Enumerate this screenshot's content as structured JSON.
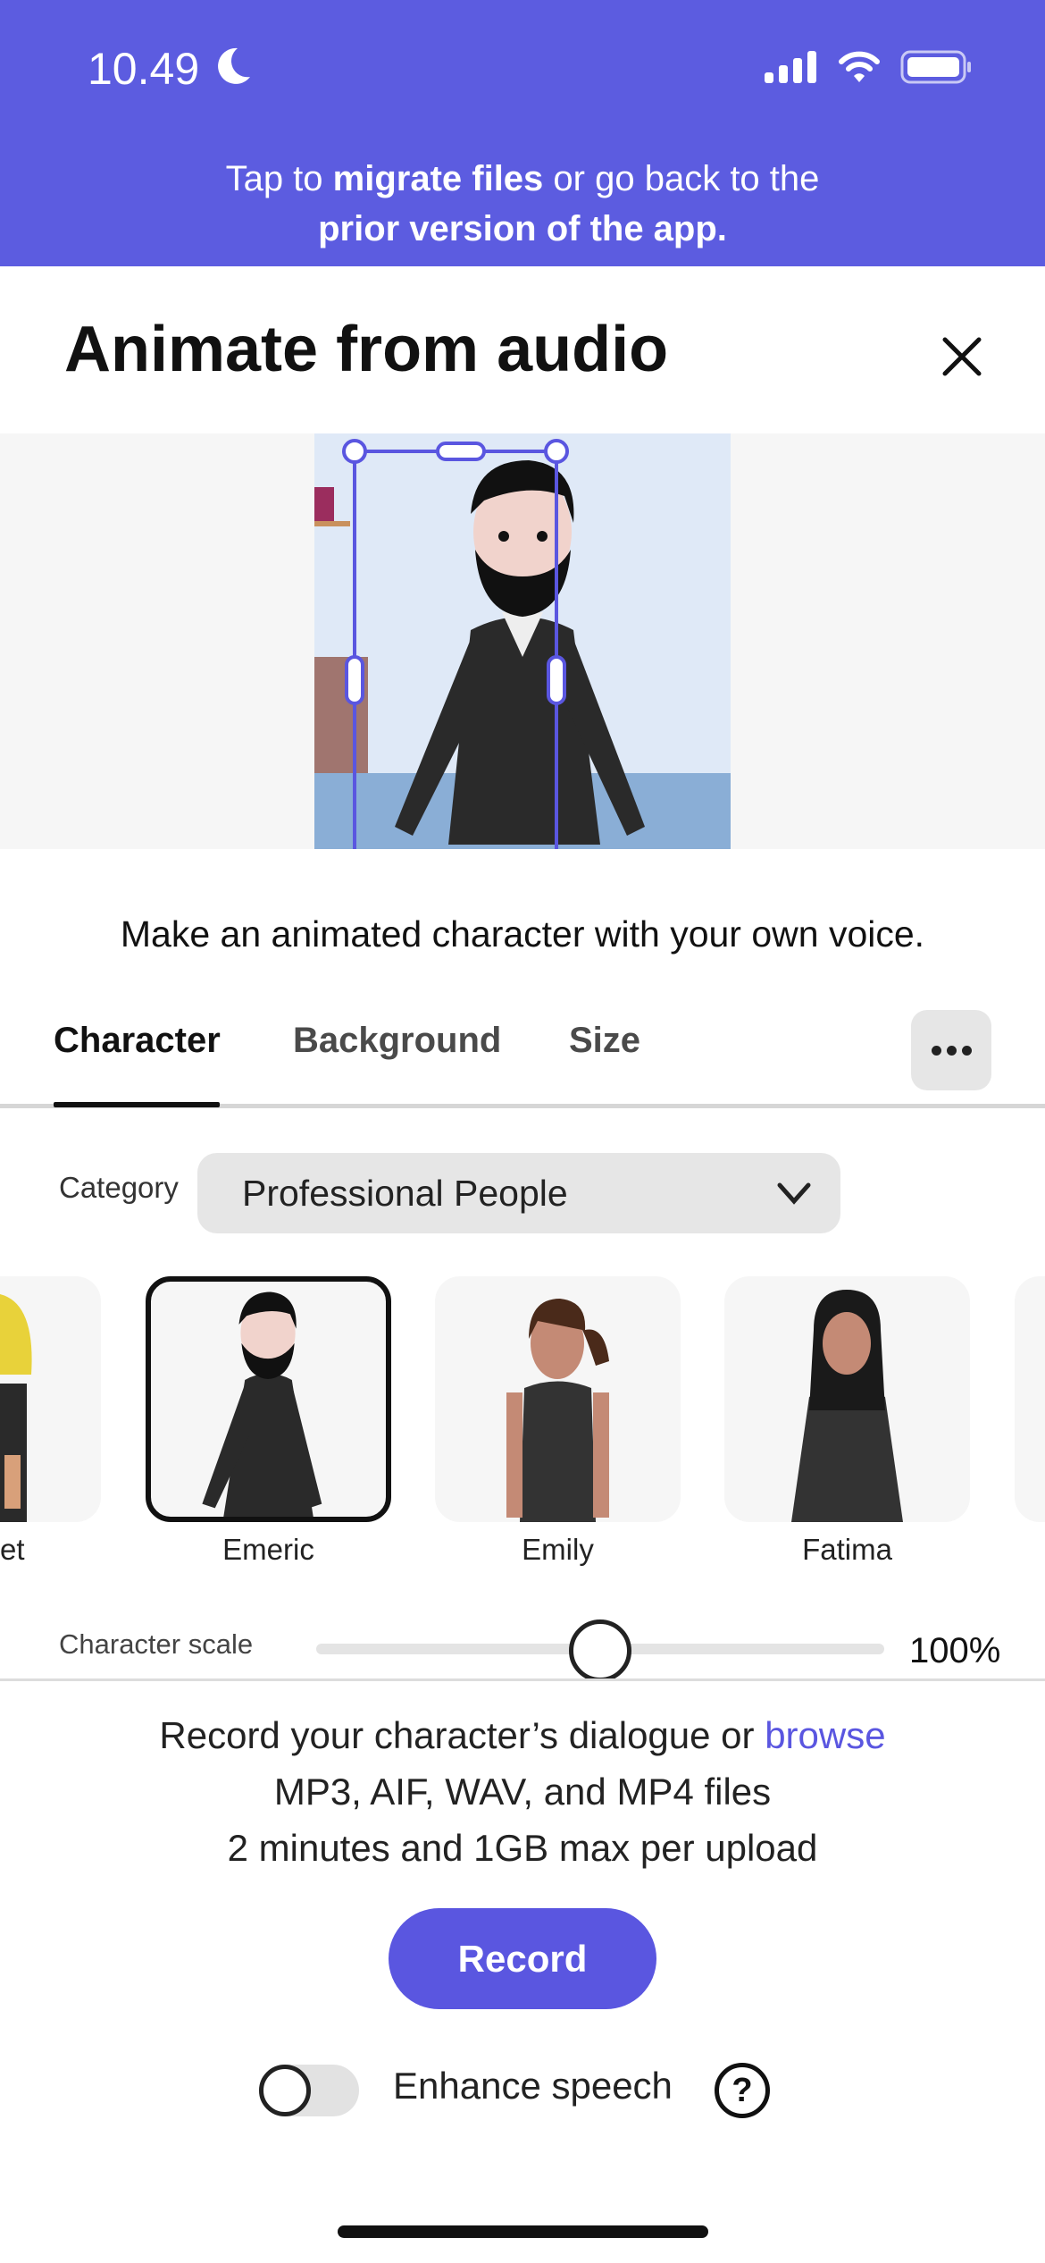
{
  "status_bar": {
    "time": "10.49",
    "icons": [
      "moon-icon",
      "signal-icon",
      "wifi-icon",
      "battery-icon"
    ]
  },
  "banner": {
    "pre": "Tap to ",
    "link1": "migrate files",
    "mid": " or go back to the",
    "link2": "prior version of the app."
  },
  "header": {
    "title": "Animate from audio",
    "close_icon": "close-icon"
  },
  "subtitle": "Make an animated character with your own voice.",
  "tabs": [
    {
      "label": "Character",
      "active": true
    },
    {
      "label": "Background"
    },
    {
      "label": "Size"
    }
  ],
  "more_icon": "ellipsis-icon",
  "category": {
    "label": "Category",
    "value": "Professional People"
  },
  "characters": [
    {
      "name": "et"
    },
    {
      "name": "Emeric",
      "selected": true
    },
    {
      "name": "Emily"
    },
    {
      "name": "Fatima"
    }
  ],
  "scale": {
    "label": "Character scale",
    "value": "100%",
    "fraction": 0.5
  },
  "upload": {
    "line1": "Record your character’s dialogue or ",
    "browse": "browse",
    "line2": "MP3, AIF, WAV, and MP4 files",
    "line3": "2 minutes and 1GB max per upload"
  },
  "record_label": "Record",
  "enhance": {
    "label": "Enhance speech",
    "enabled": false
  },
  "colors": {
    "accent": "#5a56e0",
    "banner": "#5c5ce0"
  }
}
